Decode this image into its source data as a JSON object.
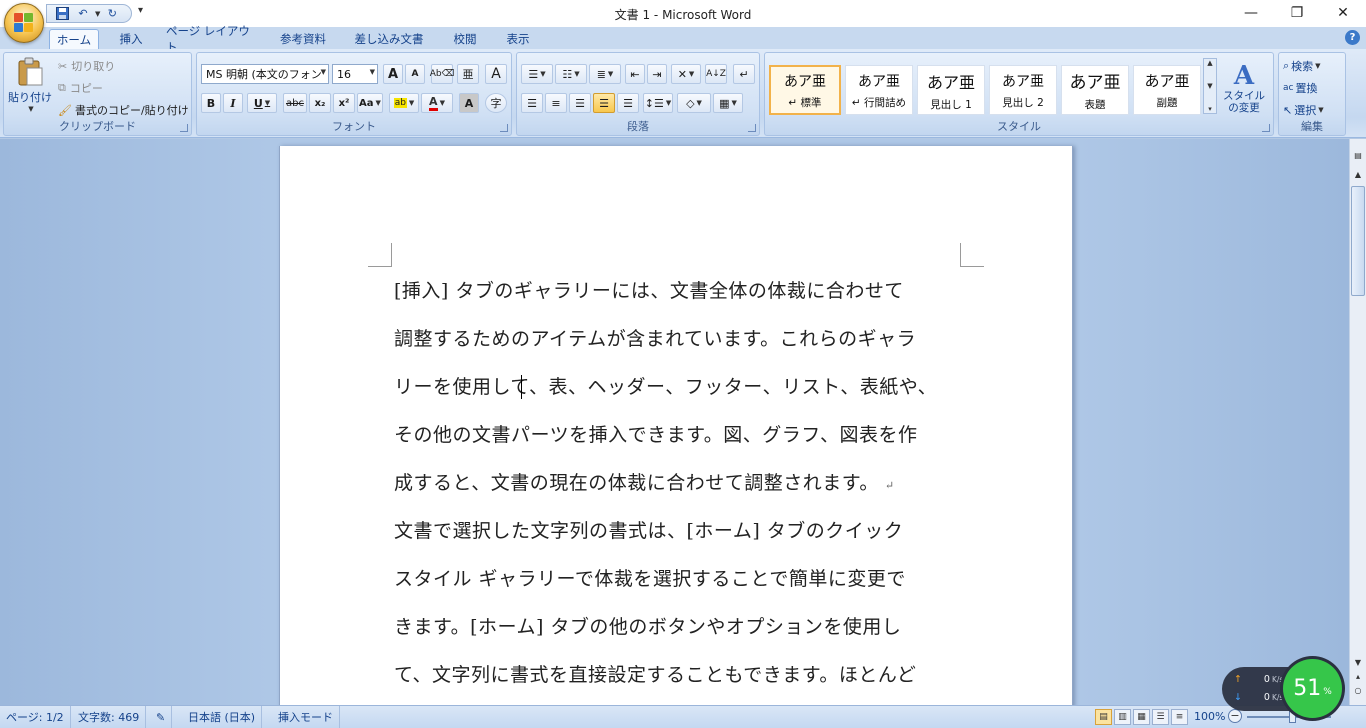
{
  "window": {
    "title": "文書 1 - Microsoft Word",
    "minimize": "—",
    "restore": "❐",
    "close": "✕"
  },
  "qat": {
    "save_icon": "save-icon",
    "undo_icon": "undo-icon",
    "redo_icon": "redo-icon"
  },
  "tabs": [
    {
      "label": "ホーム"
    },
    {
      "label": "挿入"
    },
    {
      "label": "ページ レイアウト"
    },
    {
      "label": "参考資料"
    },
    {
      "label": "差し込み文書"
    },
    {
      "label": "校閲"
    },
    {
      "label": "表示"
    }
  ],
  "clipboard": {
    "paste": "貼り付け",
    "cut": "切り取り",
    "copy": "コピー",
    "format_painter": "書式のコピー/貼り付け",
    "label": "クリップボード"
  },
  "font": {
    "name": "MS 明朝 (本文のフォン",
    "size": "16",
    "label": "フォント",
    "bold": "B",
    "italic": "I",
    "underline": "U",
    "strike": "abc",
    "subscript": "x₂",
    "superscript": "x²",
    "change_case": "Aa",
    "grow": "A",
    "shrink": "A",
    "phonetic": "亜",
    "clear": "A",
    "highlight": "ab",
    "color": "A",
    "char_border": "A",
    "enclose": "字"
  },
  "paragraph": {
    "label": "段落"
  },
  "styles": {
    "label": "スタイル",
    "items": [
      {
        "sample": "あア亜",
        "name": "↵ 標準"
      },
      {
        "sample": "あア亜",
        "name": "↵ 行間詰め"
      },
      {
        "sample": "あア亜",
        "name": "見出し 1"
      },
      {
        "sample": "あア亜",
        "name": "見出し 2"
      },
      {
        "sample": "あア亜",
        "name": "表題"
      },
      {
        "sample": "あア亜",
        "name": "副題"
      }
    ],
    "change": "スタイルの変更"
  },
  "editing": {
    "label": "編集",
    "find": "検索",
    "replace": "置換",
    "select": "選択"
  },
  "document": {
    "paragraph1": [
      "[挿入] タブのギャラリーには、文書全体の体裁に合わせて",
      "調整するためのアイテムが含まれています。これらのギャラ",
      "リーを使用して、表、ヘッダー、フッター、リスト、表紙や、",
      "その他の文書パーツを挿入できます。図、グラフ、図表を作",
      "成すると、文書の現在の体裁に合わせて調整されます。"
    ],
    "paragraph2": [
      "文書で選択した文字列の書式は、[ホーム] タブのクイック",
      "スタイル ギャラリーで体裁を選択することで簡単に変更で",
      "きます。[ホーム] タブの他のボタンやオプションを使用し",
      "て、文字列に書式を直接設定することもできます。ほとんど"
    ],
    "pmark": "↵"
  },
  "status": {
    "page": "ページ: 1/2",
    "words": "文字数: 469",
    "language": "日本語 (日本)",
    "mode": "挿入モード",
    "zoom": "100%"
  },
  "net": {
    "up": "0",
    "down": "0",
    "unit": "K/s",
    "percent": "51",
    "percent_sign": "%"
  },
  "colors": {
    "accent": "#15428b",
    "highlight": "#f5e300",
    "font_color": "#e00000",
    "net_green": "#36c64a"
  }
}
